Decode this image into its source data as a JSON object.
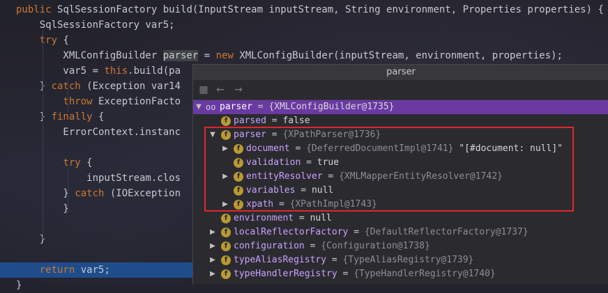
{
  "code": {
    "lines": [
      {
        "parts": [
          {
            "t": "public ",
            "k": "kw"
          },
          {
            "t": "SqlSessionFactory build(InputStream inputStream, String environment, Properties properties) {",
            "k": ""
          }
        ]
      },
      {
        "parts": [
          {
            "t": "    SqlSessionFactory var5;",
            "k": ""
          }
        ]
      },
      {
        "parts": [
          {
            "t": "    ",
            "k": ""
          },
          {
            "t": "try",
            "k": "kw"
          },
          {
            "t": " {",
            "k": ""
          }
        ]
      },
      {
        "parts": [
          {
            "t": "        XMLConfigBuilder ",
            "k": ""
          },
          {
            "t": "parser",
            "k": "hl"
          },
          {
            "t": " = ",
            "k": ""
          },
          {
            "t": "new ",
            "k": "kw"
          },
          {
            "t": "XMLConfigBuilder(inputStream, environment, properties);",
            "k": ""
          }
        ]
      },
      {
        "parts": [
          {
            "t": "        var5 = ",
            "k": ""
          },
          {
            "t": "this",
            "k": "kw"
          },
          {
            "t": ".build(pa",
            "k": ""
          }
        ]
      },
      {
        "parts": [
          {
            "t": "    } ",
            "k": ""
          },
          {
            "t": "catch",
            "k": "kw"
          },
          {
            "t": " (Exception var14",
            "k": ""
          }
        ]
      },
      {
        "parts": [
          {
            "t": "        ",
            "k": ""
          },
          {
            "t": "throw ",
            "k": "kw"
          },
          {
            "t": "ExceptionFacto",
            "k": ""
          }
        ]
      },
      {
        "parts": [
          {
            "t": "    } ",
            "k": ""
          },
          {
            "t": "finally",
            "k": "kw"
          },
          {
            "t": " {",
            "k": ""
          }
        ]
      },
      {
        "parts": [
          {
            "t": "        ErrorContext.instanc",
            "k": ""
          }
        ]
      },
      {
        "parts": [
          {
            "t": "",
            "k": ""
          }
        ]
      },
      {
        "parts": [
          {
            "t": "        ",
            "k": ""
          },
          {
            "t": "try",
            "k": "kw"
          },
          {
            "t": " {",
            "k": ""
          }
        ]
      },
      {
        "parts": [
          {
            "t": "            inputStream.clos",
            "k": ""
          }
        ]
      },
      {
        "parts": [
          {
            "t": "        } ",
            "k": ""
          },
          {
            "t": "catch",
            "k": "kw"
          },
          {
            "t": " (IOException",
            "k": ""
          }
        ]
      },
      {
        "parts": [
          {
            "t": "        }",
            "k": ""
          }
        ]
      },
      {
        "parts": [
          {
            "t": "",
            "k": ""
          }
        ]
      },
      {
        "parts": [
          {
            "t": "    }",
            "k": ""
          }
        ]
      },
      {
        "parts": [
          {
            "t": "",
            "k": ""
          }
        ]
      },
      {
        "parts": [
          {
            "t": "    ",
            "k": ""
          },
          {
            "t": "return ",
            "k": "kw"
          },
          {
            "t": "var5;",
            "k": ""
          }
        ]
      },
      {
        "parts": [
          {
            "t": "}",
            "k": ""
          }
        ]
      }
    ],
    "selected_line": 17
  },
  "popup": {
    "title": "parser",
    "toolbar": {
      "icons": [
        "watch-icon",
        "back-arrow-icon",
        "forward-arrow-icon"
      ],
      "glyphs": [
        "▦",
        "←",
        "→"
      ]
    },
    "tree": [
      {
        "name": "parser",
        "val": "{XMLConfigBuilder@1735}",
        "depth": 0,
        "arrow": "▼",
        "icon": "oo",
        "root": true
      },
      {
        "name": "parsed",
        "val": "false",
        "depth": 1,
        "arrow": "",
        "icon": "f",
        "plain": true
      },
      {
        "name": "parser",
        "val": "{XPathParser@1736}",
        "depth": 1,
        "arrow": "▼",
        "icon": "f"
      },
      {
        "name": "document",
        "val": "{DeferredDocumentImpl@1741}",
        "extra": " \"[#document: null]\"",
        "depth": 2,
        "arrow": "▶",
        "icon": "f"
      },
      {
        "name": "validation",
        "val": "true",
        "depth": 2,
        "arrow": "",
        "icon": "f",
        "plain": true
      },
      {
        "name": "entityResolver",
        "val": "{XMLMapperEntityResolver@1742}",
        "depth": 2,
        "arrow": "▶",
        "icon": "f"
      },
      {
        "name": "variables",
        "val": "null",
        "depth": 2,
        "arrow": "",
        "icon": "f",
        "plain": true
      },
      {
        "name": "xpath",
        "val": "{XPathImpl@1743}",
        "depth": 2,
        "arrow": "▶",
        "icon": "f"
      },
      {
        "name": "environment",
        "val": "null",
        "depth": 1,
        "arrow": "",
        "icon": "f",
        "plain": true
      },
      {
        "name": "localReflectorFactory",
        "val": "{DefaultReflectorFactory@1737}",
        "depth": 1,
        "arrow": "▶",
        "icon": "f"
      },
      {
        "name": "configuration",
        "val": "{Configuration@1738}",
        "depth": 1,
        "arrow": "▶",
        "icon": "f"
      },
      {
        "name": "typeAliasRegistry",
        "val": "{TypeAliasRegistry@1739}",
        "depth": 1,
        "arrow": "▶",
        "icon": "f"
      },
      {
        "name": "typeHandlerRegistry",
        "val": "{TypeHandlerRegistry@1740}",
        "depth": 1,
        "arrow": "▶",
        "icon": "f"
      }
    ],
    "field_icon_glyph": "f",
    "object_icon_glyph": "oo",
    "eq": " = "
  }
}
